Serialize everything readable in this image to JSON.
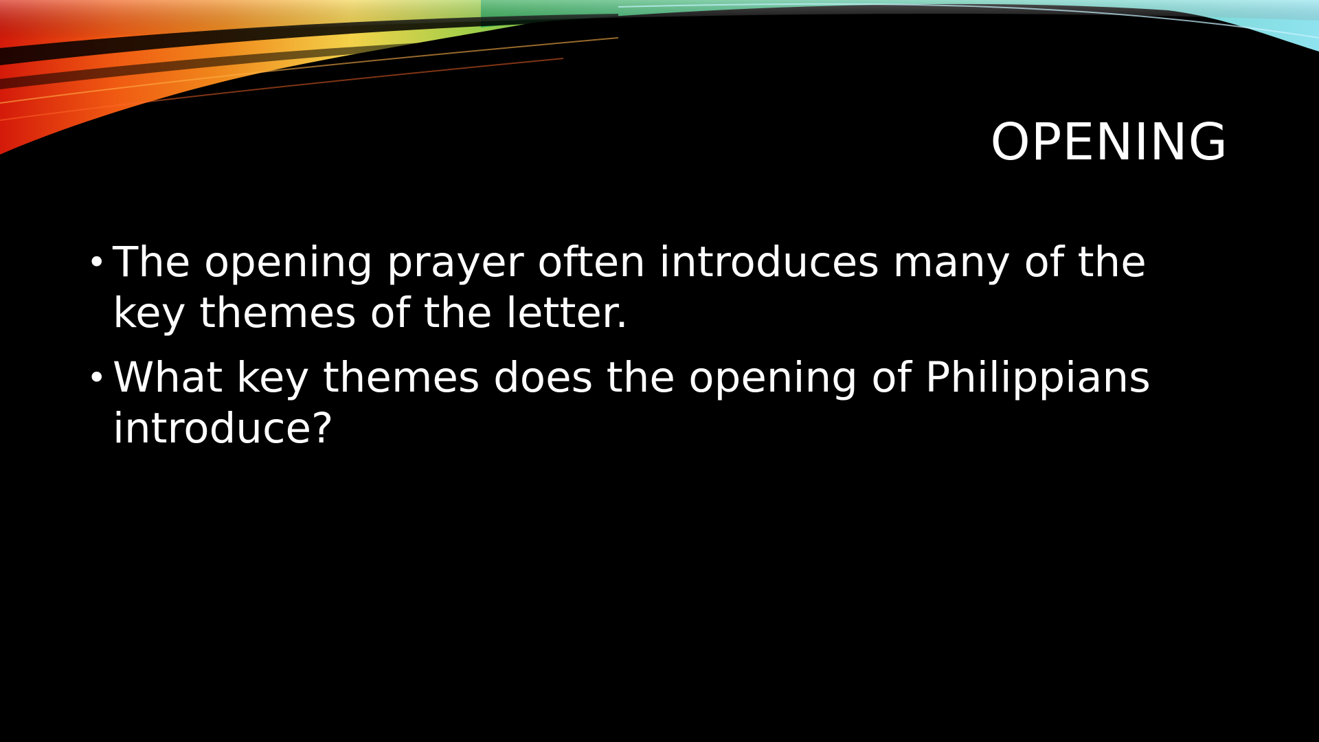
{
  "slide": {
    "title": "OPENING",
    "bullets": [
      "The opening prayer often introduces many of the key themes of the letter.",
      "What key themes does the opening of Philippians introduce?"
    ],
    "bullet_glyph": "•"
  },
  "colors": {
    "background": "#000000",
    "text": "#ffffff",
    "ribbon_red": "#d41a0a",
    "ribbon_orange": "#f08a1c",
    "ribbon_yellow": "#f3d24a",
    "ribbon_green": "#2fa84f",
    "ribbon_cyan": "#8fe3ef"
  }
}
